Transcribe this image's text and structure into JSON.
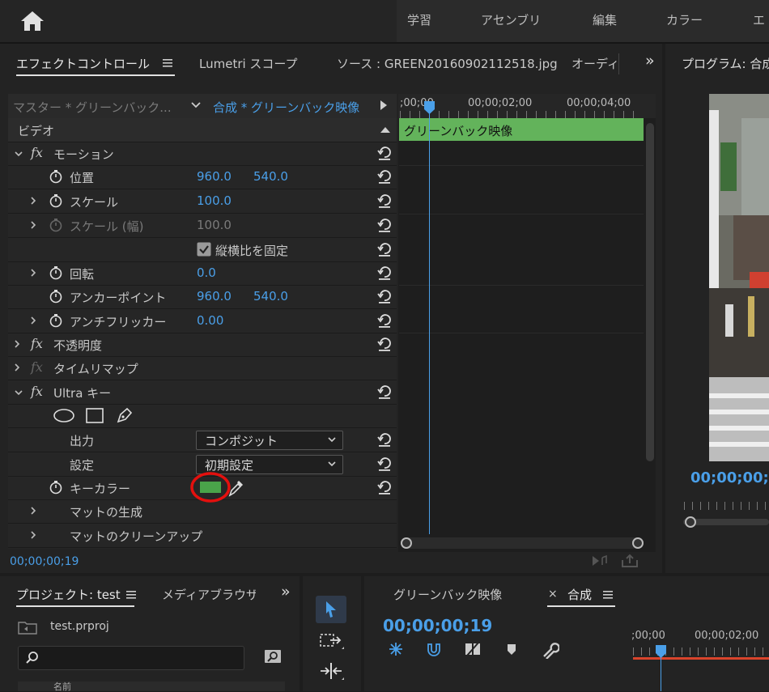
{
  "workspaces": [
    "学習",
    "アセンブリ",
    "編集",
    "カラー",
    "エ"
  ],
  "ec_tabs": {
    "effect_controls": "エフェクトコントロール",
    "lumetri": "Lumetri スコープ",
    "source": "ソース : GREEN20160902112518.jpg",
    "audio": "オーディ",
    "overflow": "»"
  },
  "program": {
    "title": "プログラム: 合成",
    "timecode": "00;00;00;1"
  },
  "header": {
    "master": "マスター * グリーンバック...",
    "sequence": "合成 * グリーンバック映像"
  },
  "ruler": {
    "t0": ";00;00",
    "t2": "00;00;02;00",
    "t4": "00;00;04;00"
  },
  "clip_name": "グリーンバック映像",
  "video_label": "ビデオ",
  "motion": {
    "label": "モーション",
    "position": {
      "label": "位置",
      "x": "960.0",
      "y": "540.0"
    },
    "scale": {
      "label": "スケール",
      "value": "100.0"
    },
    "scale_width": {
      "label": "スケール (幅)",
      "value": "100.0"
    },
    "uniform_scale": "縦横比を固定",
    "rotation": {
      "label": "回転",
      "value": "0.0"
    },
    "anchor": {
      "label": "アンカーポイント",
      "x": "960.0",
      "y": "540.0"
    },
    "antiflicker": {
      "label": "アンチフリッカー",
      "value": "0.00"
    }
  },
  "opacity_label": "不透明度",
  "time_remap_label": "タイムリマップ",
  "ultra_key": {
    "label": "Ultra キー",
    "output": {
      "label": "出力",
      "value": "コンポジット"
    },
    "setting": {
      "label": "設定",
      "value": "初期設定"
    },
    "key_color": {
      "label": "キーカラー",
      "swatch": "#4aa34a"
    },
    "matte_generation": "マットの生成",
    "matte_cleanup": "マットのクリーンアップ"
  },
  "ec_timecode": "00;00;00;19",
  "project": {
    "title": "プロジェクト: test",
    "media_browser": "メディアブラウザ",
    "file": "test.prproj",
    "col_name": "名前"
  },
  "sequence": {
    "tab1": "グリーンバック映像",
    "tab2": "合成",
    "timecode": "00;00;00;19",
    "t0": ";00;00",
    "t2": "00;00;02;00"
  }
}
